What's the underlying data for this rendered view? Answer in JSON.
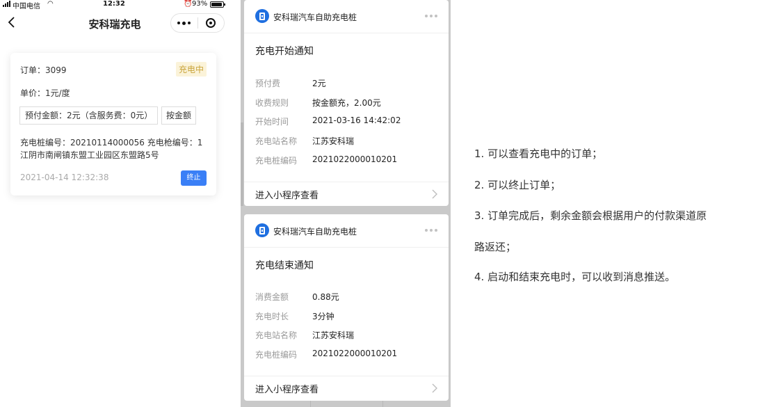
{
  "status_bar": {
    "carrier": "中国电信",
    "time": "12:32",
    "battery": "93%"
  },
  "nav": {
    "title": "安科瑞充电"
  },
  "order_card": {
    "order_no": "订单：3099",
    "status_badge": "充电中",
    "unit_price": "单价：1元/度",
    "prepay": "预付金额：2元（含服务费：0元）",
    "charge_mode": "按金额",
    "pile_info": "充电桩编号：20210114000056 充电枪编号：1",
    "address": "江阴市南闸镇东盟工业园区东盟路5号",
    "created_at": "2021-04-14 12:32:38",
    "stop_button": "终止"
  },
  "notifications": [
    {
      "app_name": "安科瑞汽车自助充电桩",
      "title": "充电开始通知",
      "fields": [
        {
          "key": "预付费",
          "value": "2元"
        },
        {
          "key": "收费规则",
          "value": "按金额充，2.00元"
        },
        {
          "key": "开始时间",
          "value": "2021-03-16 14:42:02"
        },
        {
          "key": "充电站名称",
          "value": "江苏安科瑞"
        },
        {
          "key": "充电桩编码",
          "value": "2021022000010201"
        }
      ],
      "link": "进入小程序查看"
    },
    {
      "app_name": "安科瑞汽车自助充电桩",
      "title": "充电结束通知",
      "fields": [
        {
          "key": "消费金额",
          "value": "0.88元"
        },
        {
          "key": "充电时长",
          "value": "3分钟"
        },
        {
          "key": "充电站名称",
          "value": "江苏安科瑞"
        },
        {
          "key": "充电桩编码",
          "value": "2021022000010201"
        }
      ],
      "link": "进入小程序查看"
    }
  ],
  "notes": [
    "1. 可以查看充电中的订单；",
    "2. 可以终止订单；",
    "3. 订单完成后，剩余金额会根据用户的付款渠道原",
    "路返还；",
    "4. 启动和结束充电时，可以收到消息推送。"
  ],
  "colors": {
    "accent_blue": "#3a7ff6",
    "badge_bg": "#fbf3d9",
    "badge_text": "#c9a43b",
    "app_logo": "#1f6fe0"
  },
  "icons": {
    "back": "chevron-left-icon",
    "more": "more-dots-icon",
    "close": "target-circle-icon",
    "wifi": "wifi-icon",
    "signal": "signal-bars-icon",
    "battery": "battery-icon",
    "alarm": "alarm-icon",
    "app_logo": "charging-station-icon",
    "row_chevron": "chevron-right-icon"
  }
}
